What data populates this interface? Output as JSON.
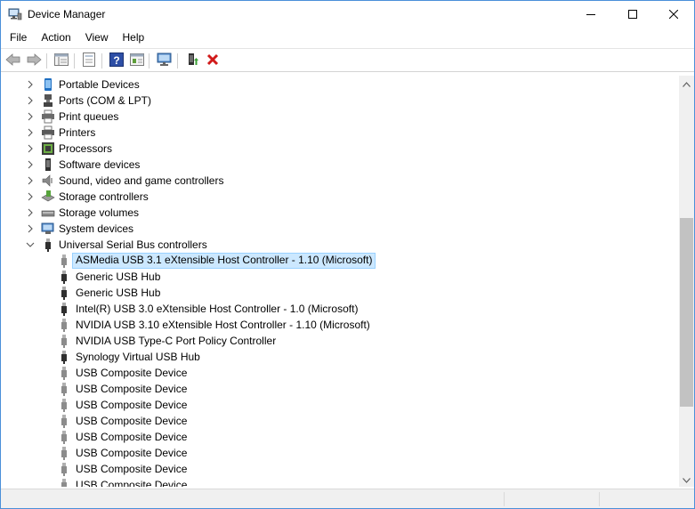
{
  "window": {
    "title": "Device Manager"
  },
  "menu": [
    "File",
    "Action",
    "View",
    "Help"
  ],
  "toolbar": [
    {
      "icon": "back-arrow-icon"
    },
    {
      "icon": "forward-arrow-icon"
    },
    {
      "icon": "device-view-icon"
    },
    {
      "icon": "properties-icon"
    },
    {
      "icon": "help-icon"
    },
    {
      "icon": "update-driver-icon"
    },
    {
      "icon": "scan-hardware-icon"
    },
    {
      "icon": "enable-device-icon"
    },
    {
      "icon": "uninstall-device-icon"
    }
  ],
  "tree": [
    {
      "label": "Portable Devices",
      "icon": "portable-device-icon",
      "level": 1,
      "expander": "collapsed"
    },
    {
      "label": "Ports (COM & LPT)",
      "icon": "port-icon",
      "level": 1,
      "expander": "collapsed"
    },
    {
      "label": "Print queues",
      "icon": "print-queue-icon",
      "level": 1,
      "expander": "collapsed"
    },
    {
      "label": "Printers",
      "icon": "printer-icon",
      "level": 1,
      "expander": "collapsed"
    },
    {
      "label": "Processors",
      "icon": "processor-icon",
      "level": 1,
      "expander": "collapsed"
    },
    {
      "label": "Software devices",
      "icon": "software-device-icon",
      "level": 1,
      "expander": "collapsed"
    },
    {
      "label": "Sound, video and game controllers",
      "icon": "speaker-icon",
      "level": 1,
      "expander": "collapsed"
    },
    {
      "label": "Storage controllers",
      "icon": "storage-controller-icon",
      "level": 1,
      "expander": "collapsed"
    },
    {
      "label": "Storage volumes",
      "icon": "storage-volume-icon",
      "level": 1,
      "expander": "collapsed"
    },
    {
      "label": "System devices",
      "icon": "system-device-icon",
      "level": 1,
      "expander": "collapsed"
    },
    {
      "label": "Universal Serial Bus controllers",
      "icon": "usb-icon",
      "level": 1,
      "expander": "expanded"
    },
    {
      "label": "ASMedia USB 3.1 eXtensible Host Controller - 1.10 (Microsoft)",
      "icon": "usb-plug-icon",
      "level": 2,
      "selected": true
    },
    {
      "label": "Generic USB Hub",
      "icon": "usb-plug-icon",
      "level": 2
    },
    {
      "label": "Generic USB Hub",
      "icon": "usb-plug-icon",
      "level": 2
    },
    {
      "label": "Intel(R) USB 3.0 eXtensible Host Controller - 1.0 (Microsoft)",
      "icon": "usb-plug-icon",
      "level": 2
    },
    {
      "label": "NVIDIA USB 3.10 eXtensible Host Controller - 1.10 (Microsoft)",
      "icon": "usb-plug-icon",
      "level": 2
    },
    {
      "label": "NVIDIA USB Type-C Port Policy Controller",
      "icon": "usb-plug-icon",
      "level": 2
    },
    {
      "label": "Synology Virtual USB Hub",
      "icon": "usb-plug-icon",
      "level": 2
    },
    {
      "label": "USB Composite Device",
      "icon": "usb-plug-icon",
      "level": 2
    },
    {
      "label": "USB Composite Device",
      "icon": "usb-plug-icon",
      "level": 2
    },
    {
      "label": "USB Composite Device",
      "icon": "usb-plug-icon",
      "level": 2
    },
    {
      "label": "USB Composite Device",
      "icon": "usb-plug-icon",
      "level": 2
    },
    {
      "label": "USB Composite Device",
      "icon": "usb-plug-icon",
      "level": 2
    },
    {
      "label": "USB Composite Device",
      "icon": "usb-plug-icon",
      "level": 2
    },
    {
      "label": "USB Composite Device",
      "icon": "usb-plug-icon",
      "level": 2
    },
    {
      "label": "USB Composite Device",
      "icon": "usb-plug-icon",
      "level": 2
    }
  ],
  "colors": {
    "selection_bg": "#cce8ff",
    "selection_border": "#99d1ff",
    "window_border": "#4a90d9"
  }
}
